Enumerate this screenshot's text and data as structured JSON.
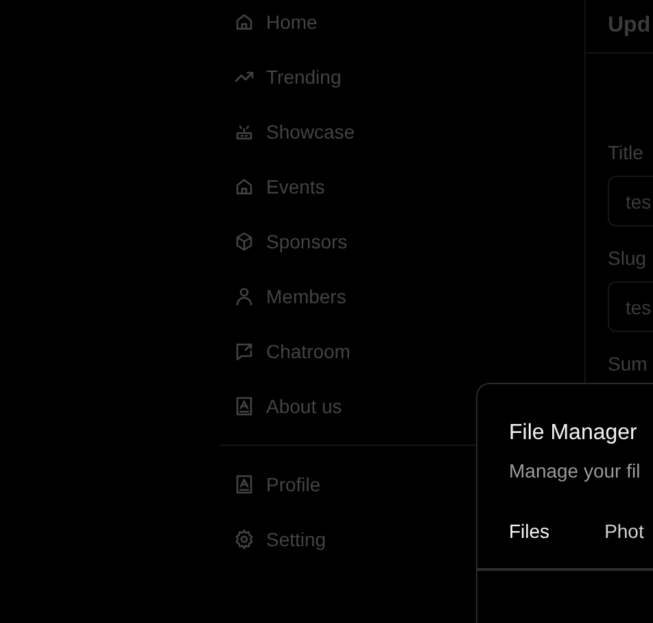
{
  "sidebar": {
    "items": [
      {
        "label": "Home"
      },
      {
        "label": "Trending"
      },
      {
        "label": "Showcase"
      },
      {
        "label": "Events"
      },
      {
        "label": "Sponsors"
      },
      {
        "label": "Members"
      },
      {
        "label": "Chatroom"
      },
      {
        "label": "About us"
      }
    ],
    "footer_items": [
      {
        "label": "Profile"
      },
      {
        "label": "Setting"
      }
    ]
  },
  "content": {
    "title": "Upd",
    "fields": [
      {
        "label": "Title",
        "value": "tes"
      },
      {
        "label": "Slug",
        "value": "tes"
      }
    ],
    "next_label": "Sum"
  },
  "dialog": {
    "title": "File Manager",
    "description": "Manage your fil",
    "tabs": [
      {
        "label": "Files",
        "selected": true
      },
      {
        "label": "Phot",
        "selected": false
      }
    ]
  }
}
